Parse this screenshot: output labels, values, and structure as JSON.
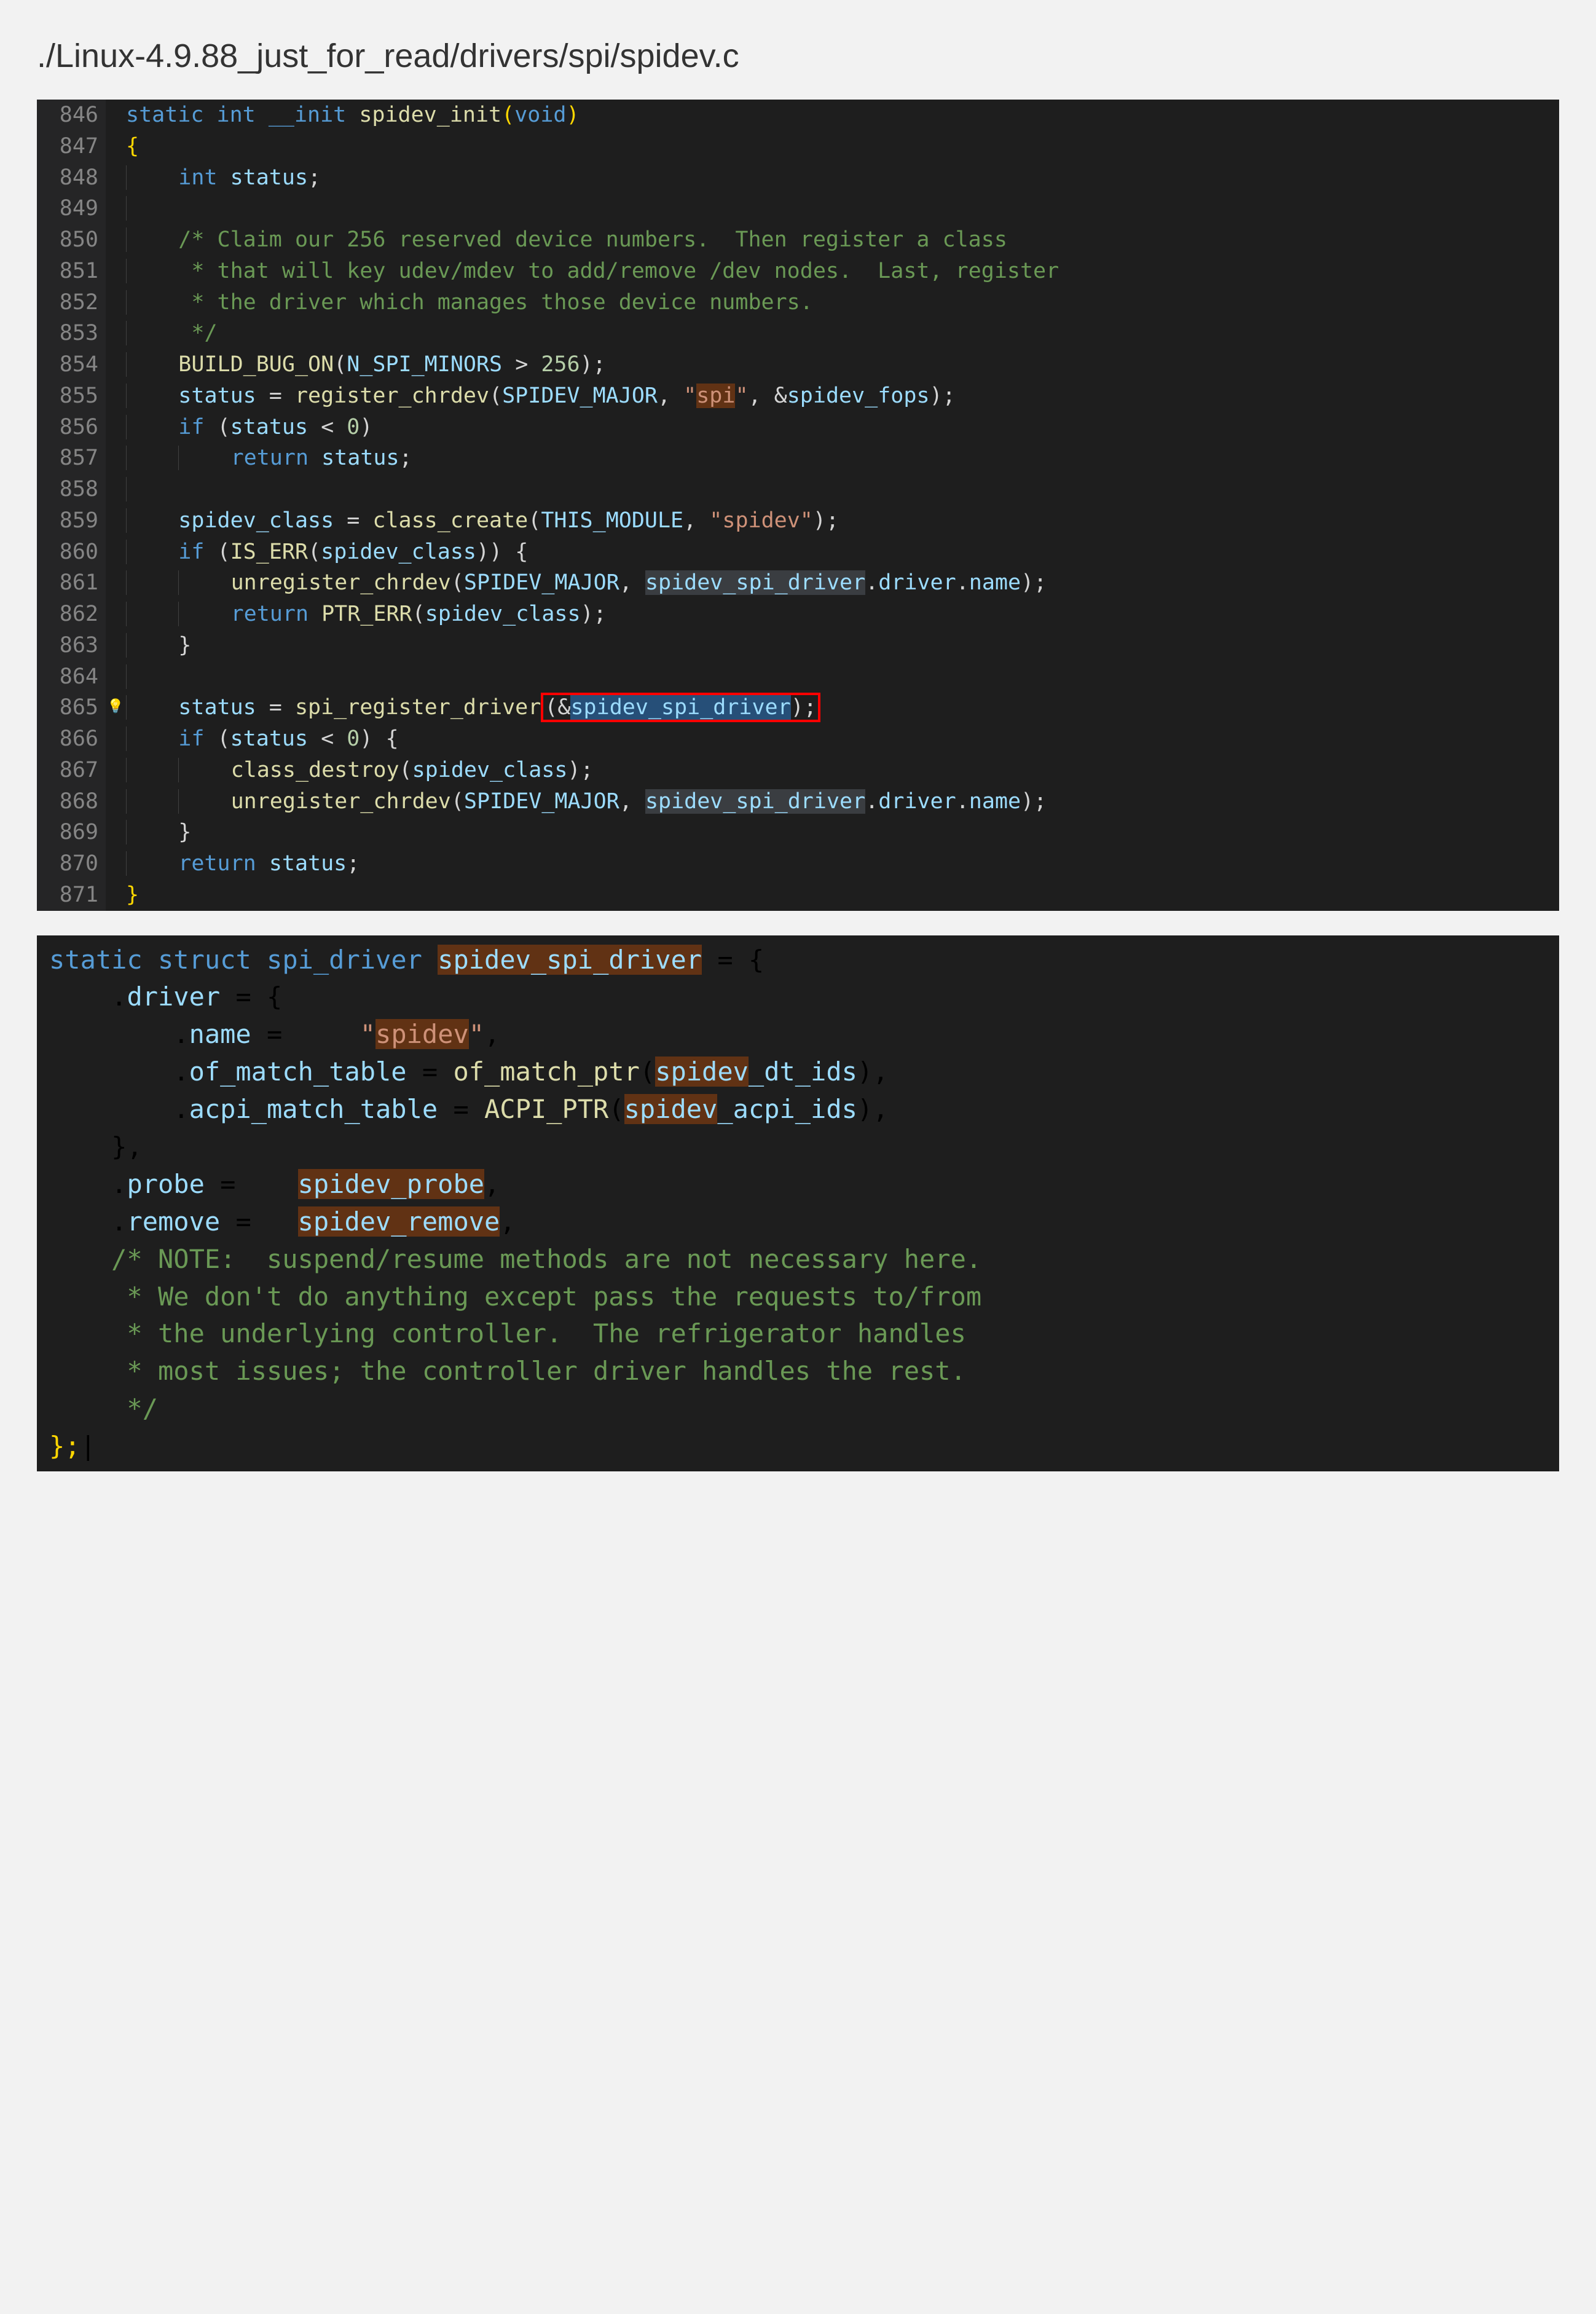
{
  "title": "./Linux-4.9.88_just_for_read/drivers/spi/spidev.c",
  "block1": {
    "startLine": 846,
    "lines": [
      {
        "n": "846",
        "t": [
          {
            "c": "kw",
            "s": "static"
          },
          {
            "s": " "
          },
          {
            "c": "type",
            "s": "int"
          },
          {
            "s": " "
          },
          {
            "c": "kw",
            "s": "__init"
          },
          {
            "s": " "
          },
          {
            "c": "fn",
            "s": "spidev_init"
          },
          {
            "c": "paren",
            "s": "("
          },
          {
            "c": "type",
            "s": "void"
          },
          {
            "c": "paren",
            "s": ")"
          }
        ]
      },
      {
        "n": "847",
        "t": [
          {
            "c": "paren",
            "s": "{"
          }
        ]
      },
      {
        "n": "848",
        "ind": 1,
        "t": [
          {
            "c": "type",
            "s": "int"
          },
          {
            "s": " "
          },
          {
            "c": "var",
            "s": "status"
          },
          {
            "s": ";"
          }
        ]
      },
      {
        "n": "849",
        "ind": 1,
        "t": []
      },
      {
        "n": "850",
        "ind": 1,
        "t": [
          {
            "c": "comment",
            "s": "/* Claim our 256 reserved device numbers.  Then register a class"
          }
        ]
      },
      {
        "n": "851",
        "ind": 1,
        "t": [
          {
            "c": "comment",
            "s": " * that will key udev/mdev to add/remove /dev nodes.  Last, register"
          }
        ]
      },
      {
        "n": "852",
        "ind": 1,
        "t": [
          {
            "c": "comment",
            "s": " * the driver which manages those device numbers."
          }
        ]
      },
      {
        "n": "853",
        "ind": 1,
        "t": [
          {
            "c": "comment",
            "s": " */"
          }
        ]
      },
      {
        "n": "854",
        "ind": 1,
        "t": [
          {
            "c": "fn",
            "s": "BUILD_BUG_ON"
          },
          {
            "s": "("
          },
          {
            "c": "var",
            "s": "N_SPI_MINORS"
          },
          {
            "s": " > "
          },
          {
            "c": "num",
            "s": "256"
          },
          {
            "s": ");"
          }
        ]
      },
      {
        "n": "855",
        "ind": 1,
        "t": [
          {
            "c": "var",
            "s": "status"
          },
          {
            "s": " = "
          },
          {
            "c": "fn",
            "s": "register_chrdev"
          },
          {
            "s": "("
          },
          {
            "c": "var",
            "s": "SPIDEV_MAJOR"
          },
          {
            "s": ", "
          },
          {
            "c": "str",
            "s": "\""
          },
          {
            "c": "str hl-orange",
            "s": "spi"
          },
          {
            "c": "str",
            "s": "\""
          },
          {
            "s": ", &"
          },
          {
            "c": "var",
            "s": "spidev_fops"
          },
          {
            "s": ");"
          }
        ]
      },
      {
        "n": "856",
        "ind": 1,
        "t": [
          {
            "c": "kw",
            "s": "if"
          },
          {
            "s": " ("
          },
          {
            "c": "var",
            "s": "status"
          },
          {
            "s": " < "
          },
          {
            "c": "num",
            "s": "0"
          },
          {
            "s": ")"
          }
        ]
      },
      {
        "n": "857",
        "ind": 2,
        "t": [
          {
            "c": "kw",
            "s": "return"
          },
          {
            "s": " "
          },
          {
            "c": "var",
            "s": "status"
          },
          {
            "s": ";"
          }
        ]
      },
      {
        "n": "858",
        "ind": 1,
        "t": []
      },
      {
        "n": "859",
        "ind": 1,
        "t": [
          {
            "c": "var",
            "s": "spidev_class"
          },
          {
            "s": " = "
          },
          {
            "c": "fn",
            "s": "class_create"
          },
          {
            "s": "("
          },
          {
            "c": "var",
            "s": "THIS_MODULE"
          },
          {
            "s": ", "
          },
          {
            "c": "str",
            "s": "\"spidev\""
          },
          {
            "s": ");"
          }
        ]
      },
      {
        "n": "860",
        "ind": 1,
        "t": [
          {
            "c": "kw",
            "s": "if"
          },
          {
            "s": " ("
          },
          {
            "c": "fn",
            "s": "IS_ERR"
          },
          {
            "s": "("
          },
          {
            "c": "var",
            "s": "spidev_class"
          },
          {
            "s": ")) {"
          }
        ]
      },
      {
        "n": "861",
        "ind": 2,
        "t": [
          {
            "c": "fn",
            "s": "unregister_chrdev"
          },
          {
            "s": "("
          },
          {
            "c": "var",
            "s": "SPIDEV_MAJOR"
          },
          {
            "s": ", "
          },
          {
            "c": "var hl-sel",
            "s": "spidev_spi_driver"
          },
          {
            "s": "."
          },
          {
            "c": "var",
            "s": "driver"
          },
          {
            "s": "."
          },
          {
            "c": "var",
            "s": "name"
          },
          {
            "s": ");"
          }
        ]
      },
      {
        "n": "862",
        "ind": 2,
        "t": [
          {
            "c": "kw",
            "s": "return"
          },
          {
            "s": " "
          },
          {
            "c": "fn",
            "s": "PTR_ERR"
          },
          {
            "s": "("
          },
          {
            "c": "var",
            "s": "spidev_class"
          },
          {
            "s": ");"
          }
        ]
      },
      {
        "n": "863",
        "ind": 1,
        "t": [
          {
            "s": "}"
          }
        ]
      },
      {
        "n": "864",
        "ind": 1,
        "t": []
      },
      {
        "n": "865",
        "ind": 1,
        "bulb": true,
        "t": [
          {
            "c": "var",
            "s": "status"
          },
          {
            "s": " = "
          },
          {
            "c": "fn",
            "s": "spi_register_driver"
          },
          {
            "red": true,
            "inner": [
              {
                "s": "(&"
              },
              {
                "c": "var hl-gray",
                "s": "spidev_spi_driver"
              },
              {
                "s": ");"
              }
            ]
          }
        ]
      },
      {
        "n": "866",
        "ind": 1,
        "t": [
          {
            "c": "kw",
            "s": "if"
          },
          {
            "s": " ("
          },
          {
            "c": "var",
            "s": "status"
          },
          {
            "s": " < "
          },
          {
            "c": "num",
            "s": "0"
          },
          {
            "s": ") {"
          }
        ]
      },
      {
        "n": "867",
        "ind": 2,
        "t": [
          {
            "c": "fn",
            "s": "class_destroy"
          },
          {
            "s": "("
          },
          {
            "c": "var",
            "s": "spidev_class"
          },
          {
            "s": ");"
          }
        ]
      },
      {
        "n": "868",
        "ind": 2,
        "t": [
          {
            "c": "fn",
            "s": "unregister_chrdev"
          },
          {
            "s": "("
          },
          {
            "c": "var",
            "s": "SPIDEV_MAJOR"
          },
          {
            "s": ", "
          },
          {
            "c": "var hl-sel",
            "s": "spidev_spi_driver"
          },
          {
            "s": "."
          },
          {
            "c": "var",
            "s": "driver"
          },
          {
            "s": "."
          },
          {
            "c": "var",
            "s": "name"
          },
          {
            "s": ");"
          }
        ]
      },
      {
        "n": "869",
        "ind": 1,
        "t": [
          {
            "s": "}"
          }
        ]
      },
      {
        "n": "870",
        "ind": 1,
        "t": [
          {
            "c": "kw",
            "s": "return"
          },
          {
            "s": " "
          },
          {
            "c": "var",
            "s": "status"
          },
          {
            "s": ";"
          }
        ]
      },
      {
        "n": "871",
        "t": [
          {
            "c": "paren",
            "s": "}"
          }
        ]
      }
    ]
  },
  "block2": {
    "lines": [
      [
        {
          "c": "kw",
          "s": "static"
        },
        {
          "s": " "
        },
        {
          "c": "kw",
          "s": "struct"
        },
        {
          "s": " "
        },
        {
          "c": "type",
          "s": "spi_driver"
        },
        {
          "s": " "
        },
        {
          "c": "var hl-orange",
          "s": "spidev_spi_driver"
        },
        {
          "s": " = {"
        }
      ],
      [
        {
          "s": "    ."
        },
        {
          "c": "var",
          "s": "driver"
        },
        {
          "s": " = {"
        }
      ],
      [
        {
          "s": "        ."
        },
        {
          "c": "var",
          "s": "name"
        },
        {
          "s": " =     "
        },
        {
          "c": "str",
          "s": "\""
        },
        {
          "c": "str hl-orange",
          "s": "spidev"
        },
        {
          "c": "str",
          "s": "\""
        },
        {
          "s": ","
        }
      ],
      [
        {
          "s": "        ."
        },
        {
          "c": "var",
          "s": "of_match_table"
        },
        {
          "s": " = "
        },
        {
          "c": "fn",
          "s": "of_match_ptr"
        },
        {
          "s": "("
        },
        {
          "c": "var hl-orange",
          "s": "spidev"
        },
        {
          "c": "var",
          "s": "_dt_ids"
        },
        {
          "s": "),"
        }
      ],
      [
        {
          "s": "        ."
        },
        {
          "c": "var",
          "s": "acpi_match_table"
        },
        {
          "s": " = "
        },
        {
          "c": "fn",
          "s": "ACPI_PTR"
        },
        {
          "s": "("
        },
        {
          "c": "var hl-orange",
          "s": "spidev"
        },
        {
          "c": "var",
          "s": "_acpi_ids"
        },
        {
          "s": "),"
        }
      ],
      [
        {
          "s": "    },"
        }
      ],
      [
        {
          "s": "    ."
        },
        {
          "c": "var",
          "s": "probe"
        },
        {
          "s": " =    "
        },
        {
          "c": "var hl-orange",
          "s": "spidev_probe"
        },
        {
          "s": ","
        }
      ],
      [
        {
          "s": "    ."
        },
        {
          "c": "var",
          "s": "remove"
        },
        {
          "s": " =   "
        },
        {
          "c": "var hl-orange",
          "s": "spidev_remove"
        },
        {
          "s": ","
        }
      ],
      [
        {
          "s": ""
        }
      ],
      [
        {
          "c": "comment",
          "s": "    /* NOTE:  suspend/resume methods are not necessary here."
        }
      ],
      [
        {
          "c": "comment",
          "s": "     * We don't do anything except pass the requests to/from"
        }
      ],
      [
        {
          "c": "comment",
          "s": "     * the underlying controller.  The refrigerator handles"
        }
      ],
      [
        {
          "c": "comment",
          "s": "     * most issues; the controller driver handles the rest."
        }
      ],
      [
        {
          "c": "comment",
          "s": "     */"
        }
      ],
      [
        {
          "c": "paren",
          "s": "};"
        },
        {
          "s": "|"
        }
      ]
    ]
  }
}
